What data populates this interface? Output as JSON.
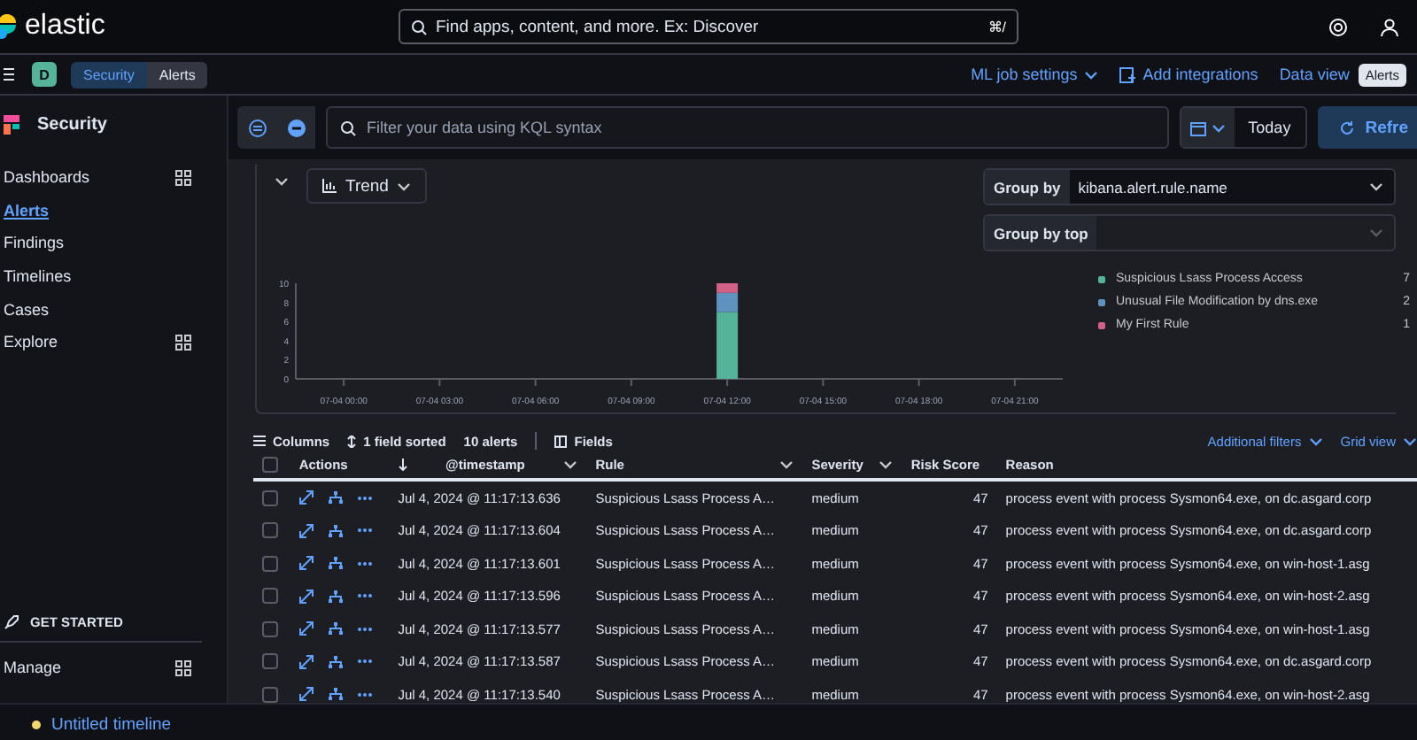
{
  "header": {
    "logo": "elastic",
    "search": {
      "placeholder": "Find apps, content, and more. Ex: Discover",
      "shortcut": "⌘/"
    }
  },
  "subbar": {
    "avatar": "D",
    "breadcrumbs": [
      {
        "label": "Security",
        "selected": false
      },
      {
        "label": "Alerts",
        "selected": true
      }
    ],
    "ml_job_settings": "ML job settings",
    "add_integrations": "Add integrations",
    "data_view_label": "Data view",
    "data_view_badge": "Alerts"
  },
  "sidebar": {
    "title": "Security",
    "items": [
      {
        "label": "Dashboards",
        "selected": false,
        "has_submenu": true
      },
      {
        "label": "Alerts",
        "selected": true,
        "has_submenu": false
      },
      {
        "label": "Findings",
        "selected": false,
        "has_submenu": false
      },
      {
        "label": "Timelines",
        "selected": false,
        "has_submenu": false
      },
      {
        "label": "Cases",
        "selected": false,
        "has_submenu": false
      },
      {
        "label": "Explore",
        "selected": false,
        "has_submenu": true
      }
    ],
    "get_started": "GET STARTED",
    "manage": "Manage"
  },
  "filter_bar": {
    "placeholder": "Filter your data using KQL syntax",
    "date": "Today",
    "refresh": "Refre"
  },
  "chart_panel": {
    "view": "Trend",
    "group_by_label": "Group by",
    "group_by_value": "kibana.alert.rule.name",
    "group_by_top_label": "Group by top",
    "legend_counts": [
      "7",
      "2",
      "1"
    ],
    "chart_data": {
      "type": "bar",
      "stacked": true,
      "categories": [
        "07-04 00:00",
        "07-04 03:00",
        "07-04 06:00",
        "07-04 09:00",
        "07-04 12:00",
        "07-04 15:00",
        "07-04 18:00",
        "07-04 21:00"
      ],
      "ylim": [
        0,
        10
      ],
      "yticks": [
        0,
        2,
        4,
        6,
        8,
        10
      ],
      "series": [
        {
          "name": "Suspicious Lsass Process Access",
          "color": "#54b399",
          "values": [
            null,
            null,
            null,
            null,
            7,
            null,
            null,
            null
          ]
        },
        {
          "name": "Unusual File Modification by dns.exe",
          "color": "#6092c0",
          "values": [
            null,
            null,
            null,
            null,
            2,
            null,
            null,
            null
          ]
        },
        {
          "name": "My First Rule",
          "color": "#d36086",
          "values": [
            null,
            null,
            null,
            null,
            1,
            null,
            null,
            null
          ]
        }
      ]
    }
  },
  "table_toolbar": {
    "columns": "Columns",
    "sorted": "1 field sorted",
    "count": "10 alerts",
    "fields": "Fields",
    "additional_filters": "Additional filters",
    "grid_view": "Grid view"
  },
  "table": {
    "select_all_checked": false,
    "columns": [
      "Actions",
      "@timestamp",
      "Rule",
      "Severity",
      "Risk Score",
      "Reason"
    ],
    "rows": [
      {
        "selected": false,
        "timestamp": "Jul 4, 2024 @ 11:17:13.636",
        "rule": "Suspicious Lsass Process A…",
        "severity": "medium",
        "risk_score": "47",
        "reason": "process event with process Sysmon64.exe, on dc.asgard.corp"
      },
      {
        "selected": false,
        "timestamp": "Jul 4, 2024 @ 11:17:13.604",
        "rule": "Suspicious Lsass Process A…",
        "severity": "medium",
        "risk_score": "47",
        "reason": "process event with process Sysmon64.exe, on dc.asgard.corp"
      },
      {
        "selected": false,
        "timestamp": "Jul 4, 2024 @ 11:17:13.601",
        "rule": "Suspicious Lsass Process A…",
        "severity": "medium",
        "risk_score": "47",
        "reason": "process event with process Sysmon64.exe, on win-host-1.asg"
      },
      {
        "selected": false,
        "timestamp": "Jul 4, 2024 @ 11:17:13.596",
        "rule": "Suspicious Lsass Process A…",
        "severity": "medium",
        "risk_score": "47",
        "reason": "process event with process Sysmon64.exe, on win-host-2.asg"
      },
      {
        "selected": false,
        "timestamp": "Jul 4, 2024 @ 11:17:13.577",
        "rule": "Suspicious Lsass Process A…",
        "severity": "medium",
        "risk_score": "47",
        "reason": "process event with process Sysmon64.exe, on win-host-1.asg"
      },
      {
        "selected": false,
        "timestamp": "Jul 4, 2024 @ 11:17:13.587",
        "rule": "Suspicious Lsass Process A…",
        "severity": "medium",
        "risk_score": "47",
        "reason": "process event with process Sysmon64.exe, on dc.asgard.corp"
      },
      {
        "selected": false,
        "timestamp": "Jul 4, 2024 @ 11:17:13.540",
        "rule": "Suspicious Lsass Process A…",
        "severity": "medium",
        "risk_score": "47",
        "reason": "process event with process Sysmon64.exe, on win-host-2.asg"
      }
    ]
  },
  "bottom_bar": {
    "timeline": "Untitled timeline"
  }
}
